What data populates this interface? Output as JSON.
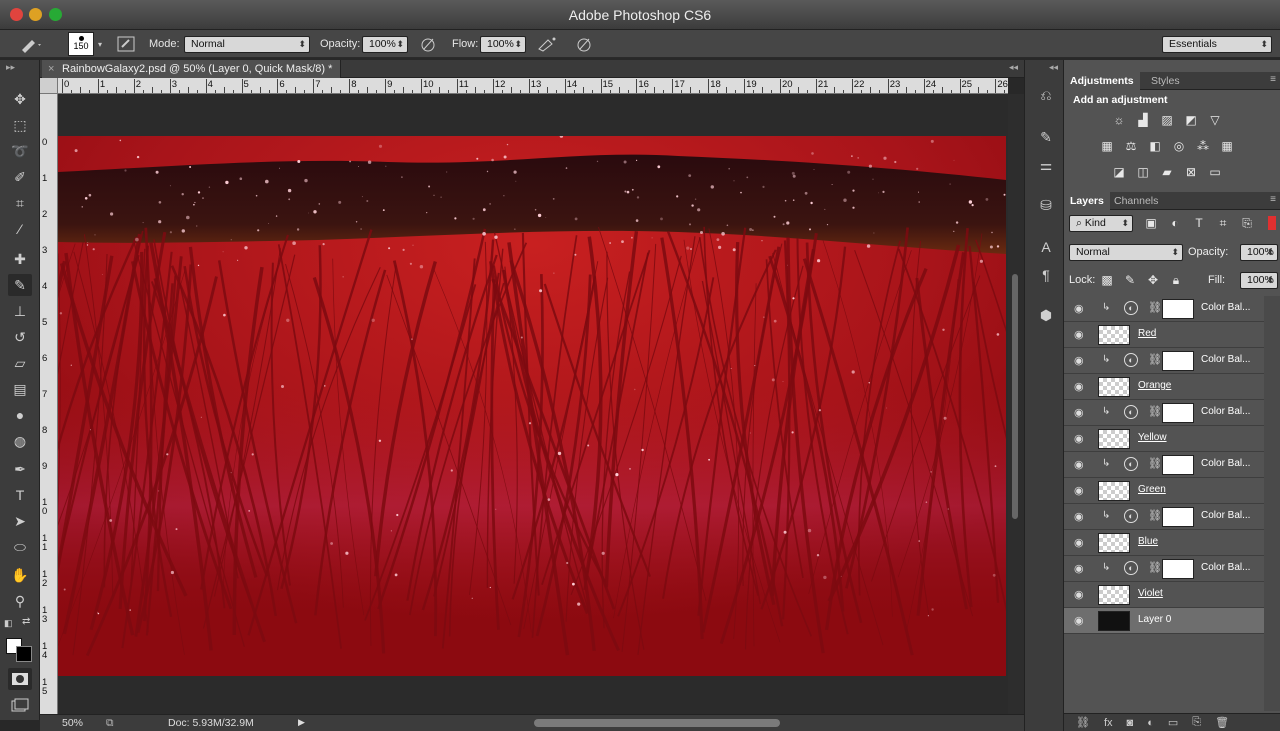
{
  "window": {
    "title": "Adobe Photoshop CS6"
  },
  "options": {
    "brush_size": "150",
    "mode_label": "Mode:",
    "mode_value": "Normal",
    "opacity_label": "Opacity:",
    "opacity_value": "100%",
    "flow_label": "Flow:",
    "flow_value": "100%",
    "workspace": "Essentials"
  },
  "document": {
    "tab_title": "RainbowGalaxy2.psd @ 50% (Layer 0, Quick Mask/8) *",
    "zoom": "50%",
    "doc_size": "Doc: 5.93M/32.9M"
  },
  "ruler": {
    "top": [
      "0",
      "1",
      "2",
      "3",
      "4",
      "5",
      "6",
      "7",
      "8",
      "9",
      "10",
      "11",
      "12",
      "13",
      "14",
      "15",
      "16",
      "17",
      "18",
      "19",
      "20",
      "21",
      "22",
      "23",
      "24",
      "25",
      "26"
    ],
    "left": [
      "0",
      "1",
      "2",
      "3",
      "4",
      "5",
      "6",
      "7",
      "8",
      "9",
      "1 0",
      "1 1",
      "1 2",
      "1 3",
      "1 4",
      "1 5"
    ]
  },
  "tools": [
    "move-icon",
    "marquee-icon",
    "lasso-icon",
    "quick-select-icon",
    "crop-icon",
    "eyedropper-icon",
    "spot-heal-icon",
    "brush-icon",
    "stamp-icon",
    "history-brush-icon",
    "eraser-icon",
    "gradient-icon",
    "blur-icon",
    "dodge-icon",
    "pen-icon",
    "type-icon",
    "path-select-icon",
    "shape-icon",
    "hand-icon",
    "zoom-icon"
  ],
  "colors": {
    "accent_red": "#8c0a10",
    "panel_bg": "#535353",
    "app_bg": "#282828"
  },
  "adjustments": {
    "tab": "Adjustments",
    "tab2": "Styles",
    "heading": "Add an adjustment"
  },
  "layers_panel": {
    "tab": "Layers",
    "tab2": "Channels",
    "filter": "Kind",
    "blend": "Normal",
    "opacity_label": "Opacity:",
    "opacity": "100%",
    "lock_label": "Lock:",
    "fill_label": "Fill:",
    "fill": "100%",
    "layers": [
      {
        "name": "Color Bal...",
        "kind": "adjustment"
      },
      {
        "name": "Red",
        "kind": "pixel"
      },
      {
        "name": "Color Bal...",
        "kind": "adjustment"
      },
      {
        "name": "Orange",
        "kind": "pixel"
      },
      {
        "name": "Color Bal...",
        "kind": "adjustment"
      },
      {
        "name": "Yellow",
        "kind": "pixel"
      },
      {
        "name": "Color Bal...",
        "kind": "adjustment"
      },
      {
        "name": "Green",
        "kind": "pixel"
      },
      {
        "name": "Color Bal...",
        "kind": "adjustment"
      },
      {
        "name": "Blue",
        "kind": "pixel"
      },
      {
        "name": "Color Bal...",
        "kind": "adjustment"
      },
      {
        "name": "Violet",
        "kind": "pixel"
      },
      {
        "name": "Layer 0",
        "kind": "base"
      }
    ]
  }
}
